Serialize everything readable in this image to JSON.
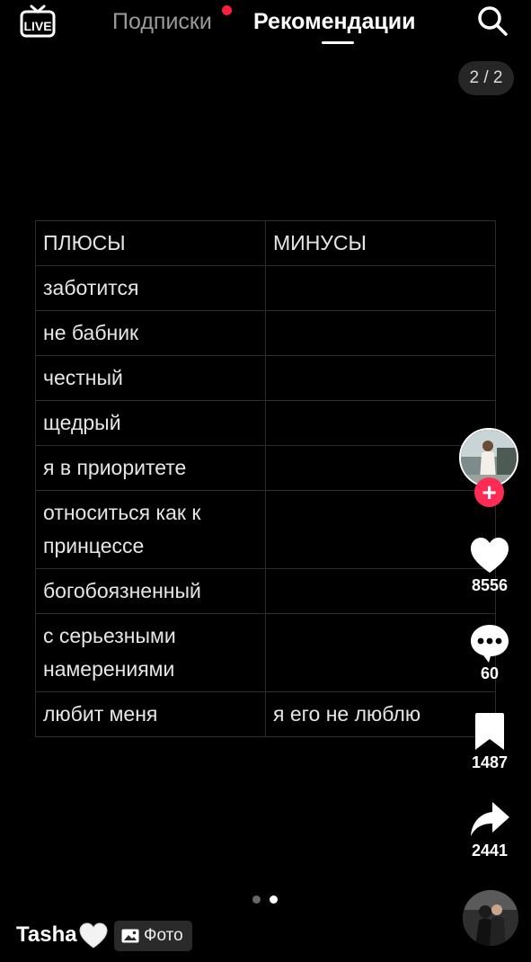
{
  "header": {
    "live_label": "LIVE",
    "tabs": [
      {
        "label": "Подписки",
        "active": false,
        "has_notification": true
      },
      {
        "label": "Рекомендации",
        "active": true
      }
    ],
    "search_icon": "search-icon"
  },
  "post": {
    "page_counter": "2 / 2",
    "table": {
      "headers": [
        "ПЛЮСЫ",
        "МИНУСЫ"
      ],
      "rows": [
        [
          "заботится",
          ""
        ],
        [
          "не бабник",
          ""
        ],
        [
          "честный",
          ""
        ],
        [
          "щедрый",
          ""
        ],
        [
          "я в приоритете",
          ""
        ],
        [
          "относиться как к принцессе",
          ""
        ],
        [
          "богобоязненный",
          ""
        ],
        [
          "с серьезными намерениями",
          ""
        ],
        [
          "любит меня",
          "я его не люблю"
        ]
      ]
    },
    "carousel": {
      "total": 2,
      "current": 2
    }
  },
  "sidebar": {
    "follow_label": "+",
    "likes": "8556",
    "comments": "60",
    "saves": "1487",
    "shares": "2441"
  },
  "author": {
    "username": "Tasha",
    "username_emoji": "white-heart-icon",
    "media_type_label": "Фото"
  },
  "colors": {
    "accent": "#fe2c55",
    "notification_dot": "#ff1f3d",
    "background": "#000000"
  }
}
